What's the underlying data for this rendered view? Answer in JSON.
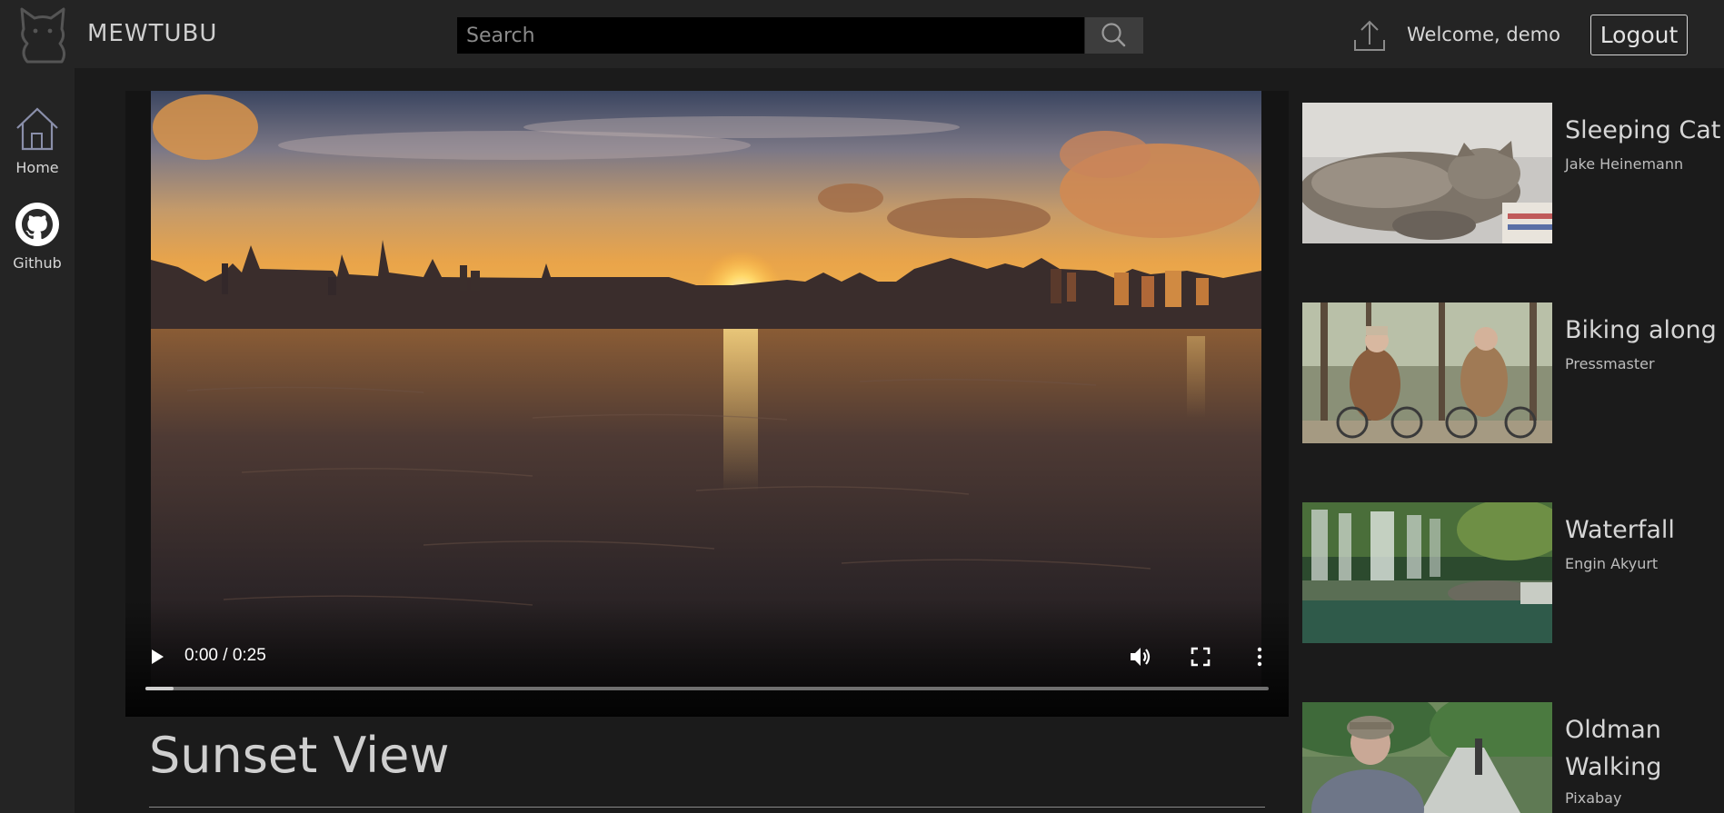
{
  "header": {
    "brand": "MEWTUBU",
    "search_placeholder": "Search",
    "welcome": "Welcome, demo",
    "logout_label": "Logout",
    "icons": [
      "cat-logo-icon",
      "search-icon",
      "upload-icon"
    ]
  },
  "sidebar": {
    "items": [
      {
        "label": "Home",
        "icon": "home-icon"
      },
      {
        "label": "Github",
        "icon": "github-icon"
      }
    ]
  },
  "player": {
    "time": "0:00 / 0:25",
    "progress": 0.025,
    "icons": [
      "play-icon",
      "volume-icon",
      "fullscreen-icon",
      "more-vert-icon"
    ]
  },
  "video": {
    "title": "Sunset View"
  },
  "suggestions": [
    {
      "title": "Sleeping Cat",
      "author": "Jake Heinemann"
    },
    {
      "title": "Biking along",
      "author": "Pressmaster"
    },
    {
      "title": "Waterfall",
      "author": "Engin Akyurt"
    },
    {
      "title": "Oldman Walking",
      "author": "Pixabay"
    }
  ],
  "colors": {
    "background": "#1b1b1b",
    "panel": "#242424",
    "search_field": "#000000",
    "text": "#d6d6d6"
  }
}
